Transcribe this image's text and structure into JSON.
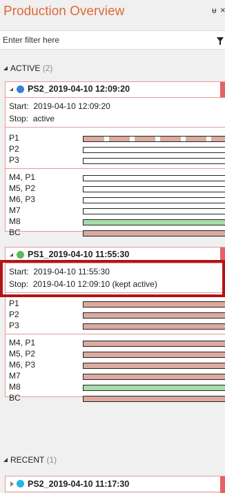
{
  "window": {
    "title": "Production Overview",
    "pin_glyph": "ᵾ",
    "close_glyph": "×"
  },
  "filter": {
    "placeholder": "Enter filter here",
    "icon": "funnel-icon"
  },
  "active_section": {
    "label": "ACTIVE",
    "count": "(2)"
  },
  "recent_section": {
    "label": "RECENT",
    "count": "(1)"
  },
  "colors": {
    "accent": "#e0673b",
    "blue_dot": "#3a7fd5",
    "green_dot": "#5cb85c",
    "cyan_dot": "#26b5e6",
    "bar_red": "#dcaaa0",
    "bar_green": "#a6dca8",
    "flag": "#e66167",
    "highlight": "#b31418"
  },
  "cards": [
    {
      "name": "PS2_2019-04-10 12:09:20",
      "status": "blue",
      "start_label": "Start:",
      "start_value": "2019-04-10 12:09:20",
      "stop_label": "Stop:",
      "stop_value": "active",
      "rows_a": [
        {
          "label": "P1",
          "state": "partial"
        },
        {
          "label": "P2",
          "state": "empty"
        },
        {
          "label": "P3",
          "state": "empty"
        }
      ],
      "rows_b": [
        {
          "label": "M4, P1",
          "state": "empty"
        },
        {
          "label": "M5, P2",
          "state": "empty"
        },
        {
          "label": "M6, P3",
          "state": "empty"
        },
        {
          "label": "M7",
          "state": "empty"
        },
        {
          "label": "M8",
          "state": "green"
        },
        {
          "label": "BC",
          "state": "red"
        }
      ]
    },
    {
      "name": "PS1_2019-04-10 11:55:30",
      "status": "green",
      "start_label": "Start:",
      "start_value": "2019-04-10 11:55:30",
      "stop_label": "Stop:",
      "stop_value": "2019-04-10 12:09:10 (kept active)",
      "rows_a": [
        {
          "label": "P1",
          "state": "red"
        },
        {
          "label": "P2",
          "state": "red"
        },
        {
          "label": "P3",
          "state": "red"
        }
      ],
      "rows_b": [
        {
          "label": "M4, P1",
          "state": "red"
        },
        {
          "label": "M5, P2",
          "state": "red"
        },
        {
          "label": "M6, P3",
          "state": "red"
        },
        {
          "label": "M7",
          "state": "red"
        },
        {
          "label": "M8",
          "state": "green"
        },
        {
          "label": "BC",
          "state": "red"
        }
      ]
    }
  ],
  "recent_cards": [
    {
      "name": "PS2_2019-04-10 11:17:30",
      "status": "cyan"
    }
  ]
}
